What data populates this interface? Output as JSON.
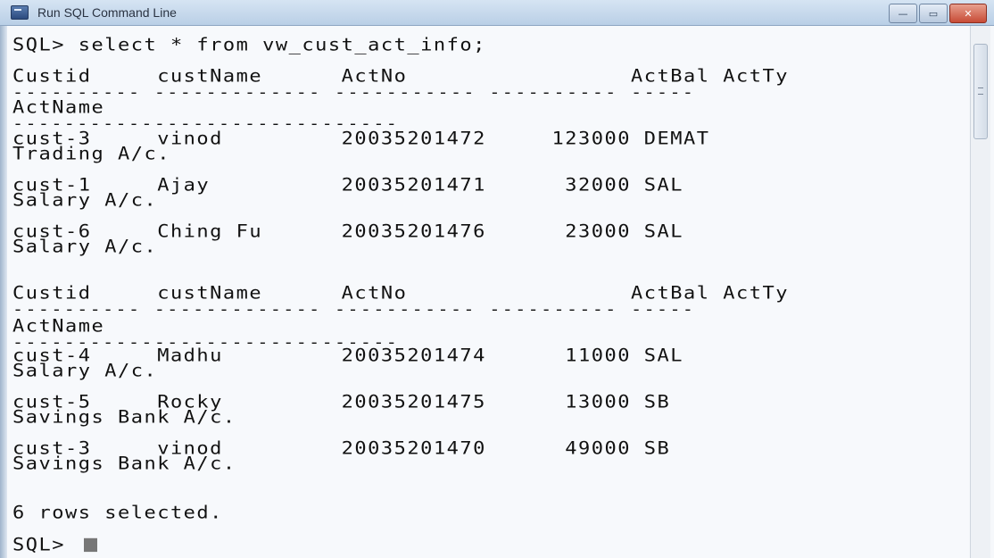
{
  "window": {
    "title": "Run SQL Command Line",
    "controls": {
      "minimize": "—",
      "maximize": "▭",
      "close": "✕"
    }
  },
  "console": {
    "lines": [
      "SQL> select * from vw_cust_act_info;",
      "Custid     custName      ActNo                 ActBal ActTy",
      "---------- ------------- ----------- ---------- -----",
      "ActName",
      "------------------------------",
      "cust-3     vinod         20035201472     123000 DEMAT",
      "Trading A/c.",
      "cust-1     Ajay          20035201471      32000 SAL",
      "Salary A/c.",
      "cust-6     Ching Fu      20035201476      23000 SAL",
      "Salary A/c.",
      "Custid     custName      ActNo                 ActBal ActTy",
      "---------- ------------- ----------- ---------- -----",
      "ActName",
      "------------------------------",
      "cust-4     Madhu         20035201474      11000 SAL",
      "Salary A/c.",
      "cust-5     Rocky         20035201475      13000 SB",
      "Savings Bank A/c.",
      "cust-3     vinod         20035201470      49000 SB",
      "Savings Bank A/c.",
      "6 rows selected.",
      "SQL> "
    ]
  }
}
